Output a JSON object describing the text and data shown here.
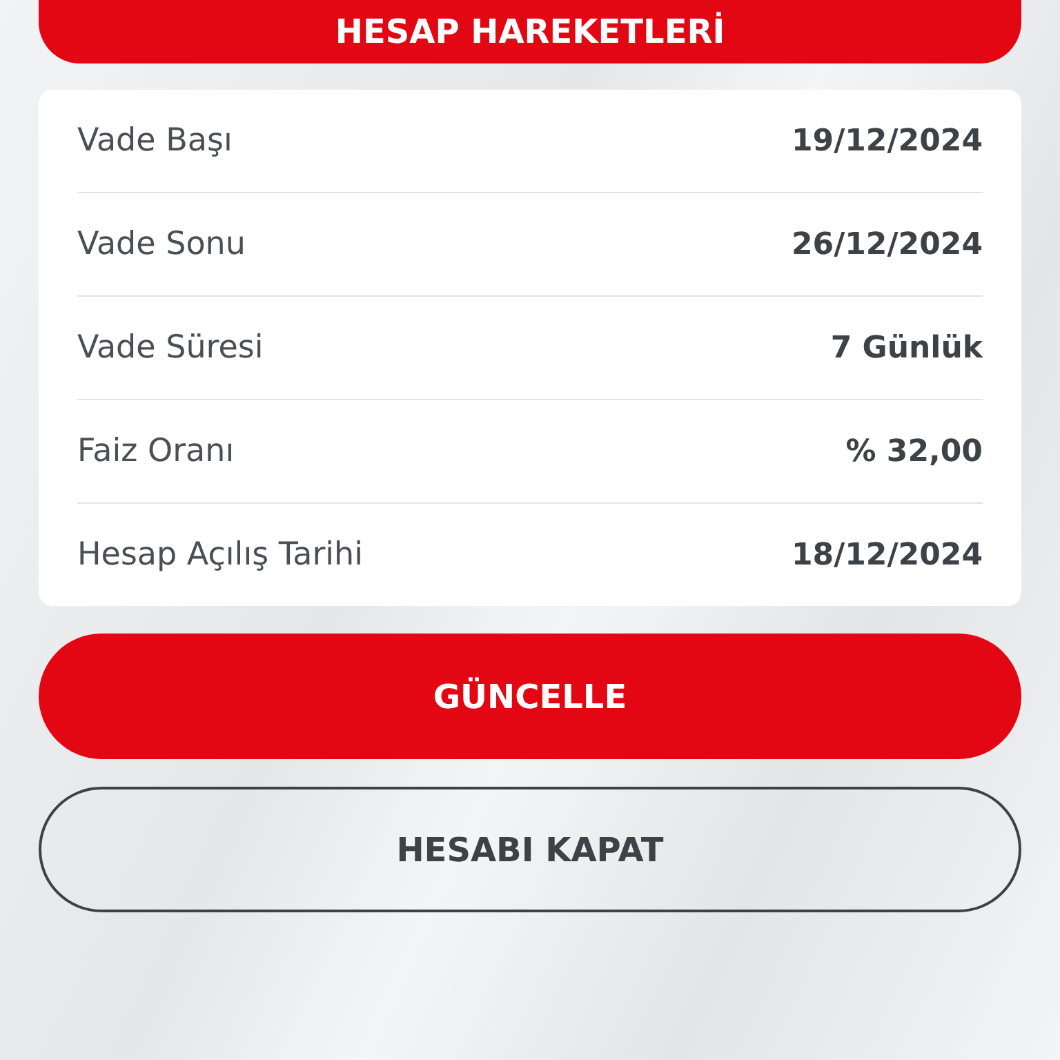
{
  "top_button": {
    "label": "HESAP HAREKETLERİ"
  },
  "details": [
    {
      "label": "Vade Başı",
      "value": "19/12/2024"
    },
    {
      "label": "Vade Sonu",
      "value": "26/12/2024"
    },
    {
      "label": "Vade Süresi",
      "value": "7 Günlük"
    },
    {
      "label": "Faiz Oranı",
      "value": "% 32,00"
    },
    {
      "label": "Hesap Açılış Tarihi",
      "value": "18/12/2024"
    }
  ],
  "buttons": [
    {
      "label": "GÜNCELLE",
      "kind": "primary"
    },
    {
      "label": "HESABI KAPAT",
      "kind": "outline"
    }
  ]
}
